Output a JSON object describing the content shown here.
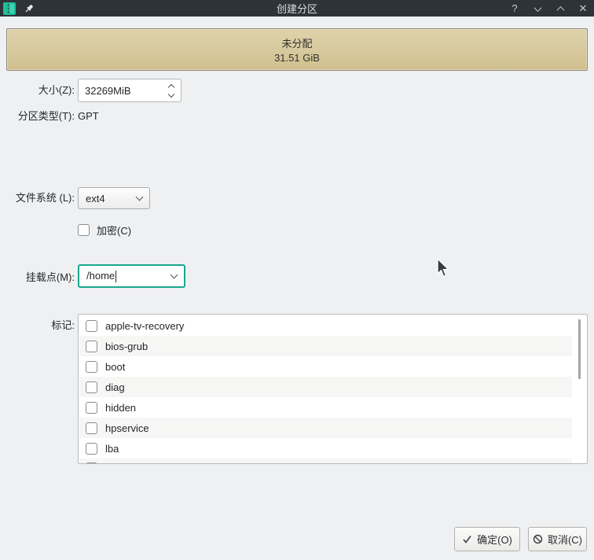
{
  "window": {
    "title": "创建分区",
    "controls": {
      "help": "?",
      "close": "✕"
    }
  },
  "partition_bar": {
    "name": "未分配",
    "size": "31.51 GiB"
  },
  "form": {
    "size": {
      "label": "大小(Z):",
      "value": "32269MiB"
    },
    "partition_type": {
      "label": "分区类型(T):",
      "value": "GPT"
    },
    "filesystem": {
      "label": "文件系统 (L):",
      "value": "ext4"
    },
    "encrypt": {
      "label": "加密(C)",
      "checked": false
    },
    "mount_point": {
      "label": "挂载点(M):",
      "value": "/home"
    },
    "flags": {
      "label": "标记:",
      "items": [
        "apple-tv-recovery",
        "bios-grub",
        "boot",
        "diag",
        "hidden",
        "hpservice",
        "lba"
      ]
    }
  },
  "buttons": {
    "ok": "确定(O)",
    "cancel": "取消(C)"
  },
  "colors": {
    "accent": "#1aa78c",
    "titlebar_bg": "#2e3338",
    "window_bg": "#eff0f1",
    "partition_fill": "#d6c79c",
    "partition_border": "#8f8878"
  }
}
